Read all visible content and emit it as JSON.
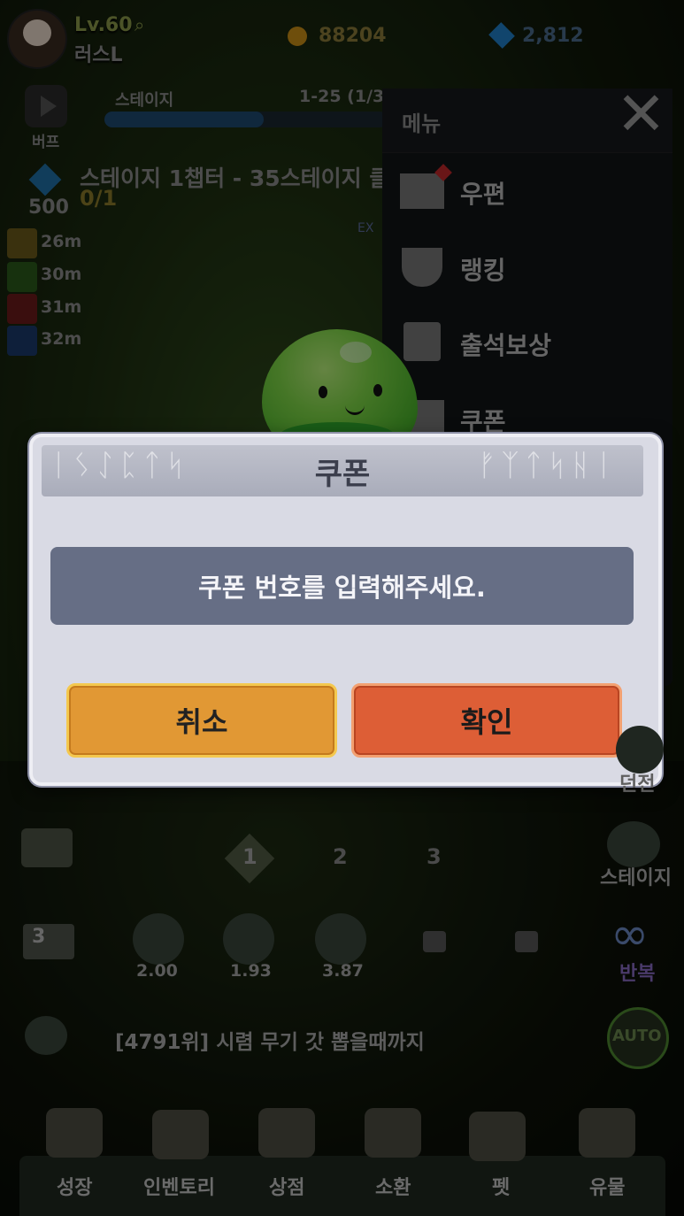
{
  "hud": {
    "level": "Lv.60",
    "player_name": "러스L",
    "coins": "88204",
    "gems": "2,812",
    "buff_label": "버프",
    "stage_label": "스테이지",
    "stage_progress": "1-25 (1/3",
    "quest_text": "스테이지 1챕터 - 35스테이지 클",
    "quest_count": "0/1",
    "quest_reward": "500",
    "exp_tag": "EX",
    "buff_timers": [
      "26m",
      "30m",
      "31m",
      "32m"
    ]
  },
  "menu": {
    "title": "메뉴",
    "items": [
      {
        "label": "우편",
        "icon": "mail-icon"
      },
      {
        "label": "랭킹",
        "icon": "trophy-icon"
      },
      {
        "label": "출석보상",
        "icon": "calendar-icon"
      },
      {
        "label": "쿠폰",
        "icon": "ticket-icon"
      }
    ]
  },
  "dialog": {
    "title": "쿠폰",
    "placeholder": "쿠폰 번호를 입력해주세요.",
    "cancel_label": "취소",
    "confirm_label": "확인"
  },
  "lower": {
    "right_label_1": "던전",
    "stage_button": "스테이지",
    "repeat_button": "반복",
    "stage_nodes": [
      "1",
      "2",
      "3"
    ],
    "skill_values": [
      "2.00",
      "1.93",
      "3.87"
    ],
    "speed_label": "3",
    "chat_message": "[4791위] 시렴 무기 갓 뽑을때까지",
    "auto_label": "AUTO"
  },
  "tabs": [
    {
      "label": "성장",
      "icon": "helmet-icon"
    },
    {
      "label": "인벤토리",
      "icon": "chest-icon"
    },
    {
      "label": "상점",
      "icon": "shop-icon"
    },
    {
      "label": "소환",
      "icon": "cards-icon"
    },
    {
      "label": "펫",
      "icon": "pet-icon"
    },
    {
      "label": "유물",
      "icon": "relic-icon"
    }
  ],
  "colors": {
    "cancel_button": "#e19834",
    "confirm_button": "#dd5e36",
    "input_bg": "#666e85",
    "dialog_bg": "#d9dae4"
  }
}
